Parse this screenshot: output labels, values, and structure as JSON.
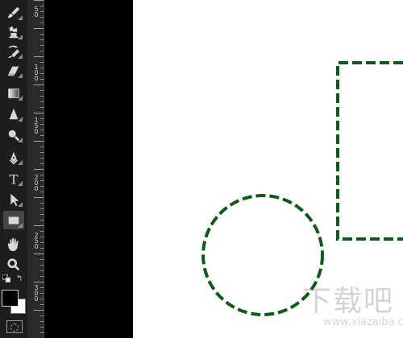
{
  "ruler": {
    "labels": [
      {
        "value": "5\n0"
      },
      {
        "value": "1\n0\n0"
      },
      {
        "value": "1\n5\n0"
      },
      {
        "value": "2\n0\n0"
      },
      {
        "value": "2\n5\n0"
      },
      {
        "value": "3\n0\n0"
      }
    ]
  },
  "tools": [
    {
      "name": "brush-tool",
      "icon": "brush-icon",
      "active": false,
      "has_menu": true
    },
    {
      "name": "clone-stamp-tool",
      "icon": "stamp-icon",
      "active": false,
      "has_menu": true
    },
    {
      "name": "history-brush-tool",
      "icon": "history-brush-icon",
      "active": false,
      "has_menu": true
    },
    {
      "name": "eraser-tool",
      "icon": "eraser-icon",
      "active": false,
      "has_menu": true
    },
    {
      "name": "gradient-tool",
      "icon": "gradient-icon",
      "active": false,
      "has_menu": true
    },
    {
      "name": "blur-tool",
      "icon": "blur-icon",
      "active": false,
      "has_menu": true
    },
    {
      "name": "dodge-tool",
      "icon": "dodge-icon",
      "active": false,
      "has_menu": true
    },
    {
      "name": "pen-tool",
      "icon": "pen-icon",
      "active": false,
      "has_menu": true
    },
    {
      "name": "type-tool",
      "icon": "type-icon",
      "active": false,
      "has_menu": true,
      "label": "T"
    },
    {
      "name": "path-selection-tool",
      "icon": "arrow-icon",
      "active": false,
      "has_menu": true
    },
    {
      "name": "rectangle-tool",
      "icon": "rectangle-icon",
      "active": true,
      "has_menu": true
    },
    {
      "name": "hand-tool",
      "icon": "hand-icon",
      "active": false,
      "has_menu": false
    },
    {
      "name": "zoom-tool",
      "icon": "zoom-icon",
      "active": false,
      "has_menu": false
    }
  ],
  "colors": {
    "foreground": "#000000",
    "background": "#ffffff",
    "shape_stroke": "#0f5a17",
    "canvas": "#ffffff",
    "pasteboard": "#000000"
  },
  "watermark": {
    "main": "下载吧",
    "url": "www.xiazaiba.com"
  }
}
